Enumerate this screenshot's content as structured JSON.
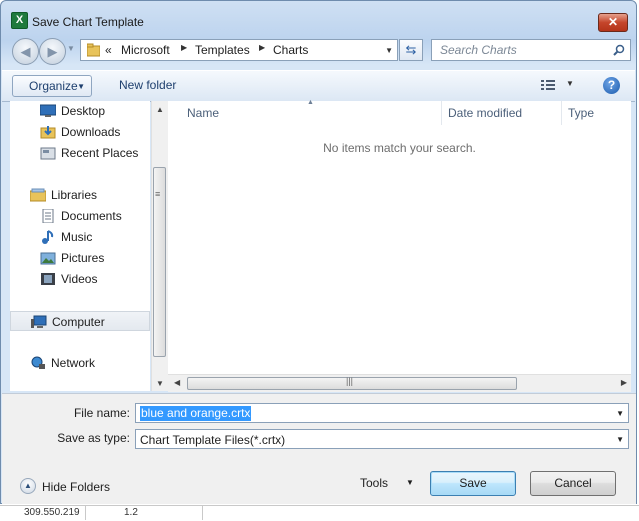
{
  "window": {
    "title": "Save Chart Template",
    "close_glyph": "✕"
  },
  "address_bar": {
    "overflow": "«",
    "segments": [
      "Microsoft",
      "Templates",
      "Charts"
    ]
  },
  "search": {
    "placeholder": "Search Charts"
  },
  "toolbar": {
    "organize_label": "Organize",
    "new_folder_label": "New folder",
    "help_glyph": "?"
  },
  "nav_pane": {
    "items": [
      {
        "label": "Desktop",
        "icon": "desktop-icon"
      },
      {
        "label": "Downloads",
        "icon": "downloads-icon"
      },
      {
        "label": "Recent Places",
        "icon": "recent-places-icon"
      },
      {
        "label": "Libraries",
        "icon": "libraries-icon"
      },
      {
        "label": "Documents",
        "icon": "documents-icon"
      },
      {
        "label": "Music",
        "icon": "music-icon"
      },
      {
        "label": "Pictures",
        "icon": "pictures-icon"
      },
      {
        "label": "Videos",
        "icon": "videos-icon"
      },
      {
        "label": "Computer",
        "icon": "computer-icon",
        "selected": true
      },
      {
        "label": "Network",
        "icon": "network-icon"
      }
    ]
  },
  "file_list": {
    "columns": [
      "Name",
      "Date modified",
      "Type"
    ],
    "empty_message": "No items match your search."
  },
  "form": {
    "file_name_label": "File name:",
    "file_name_value": "blue and orange.crtx",
    "save_as_type_label": "Save as type:",
    "save_as_type_value": "Chart Template Files(*.crtx)"
  },
  "footer": {
    "hide_folders_label": "Hide Folders",
    "tools_label": "Tools",
    "save_label": "Save",
    "cancel_label": "Cancel"
  },
  "background_peek": {
    "cell_a": "309.550.219",
    "cell_b": "1.2"
  },
  "colors": {
    "selection": "#3399ff",
    "accent": "#1e3f6e",
    "close": "#c5452b"
  }
}
